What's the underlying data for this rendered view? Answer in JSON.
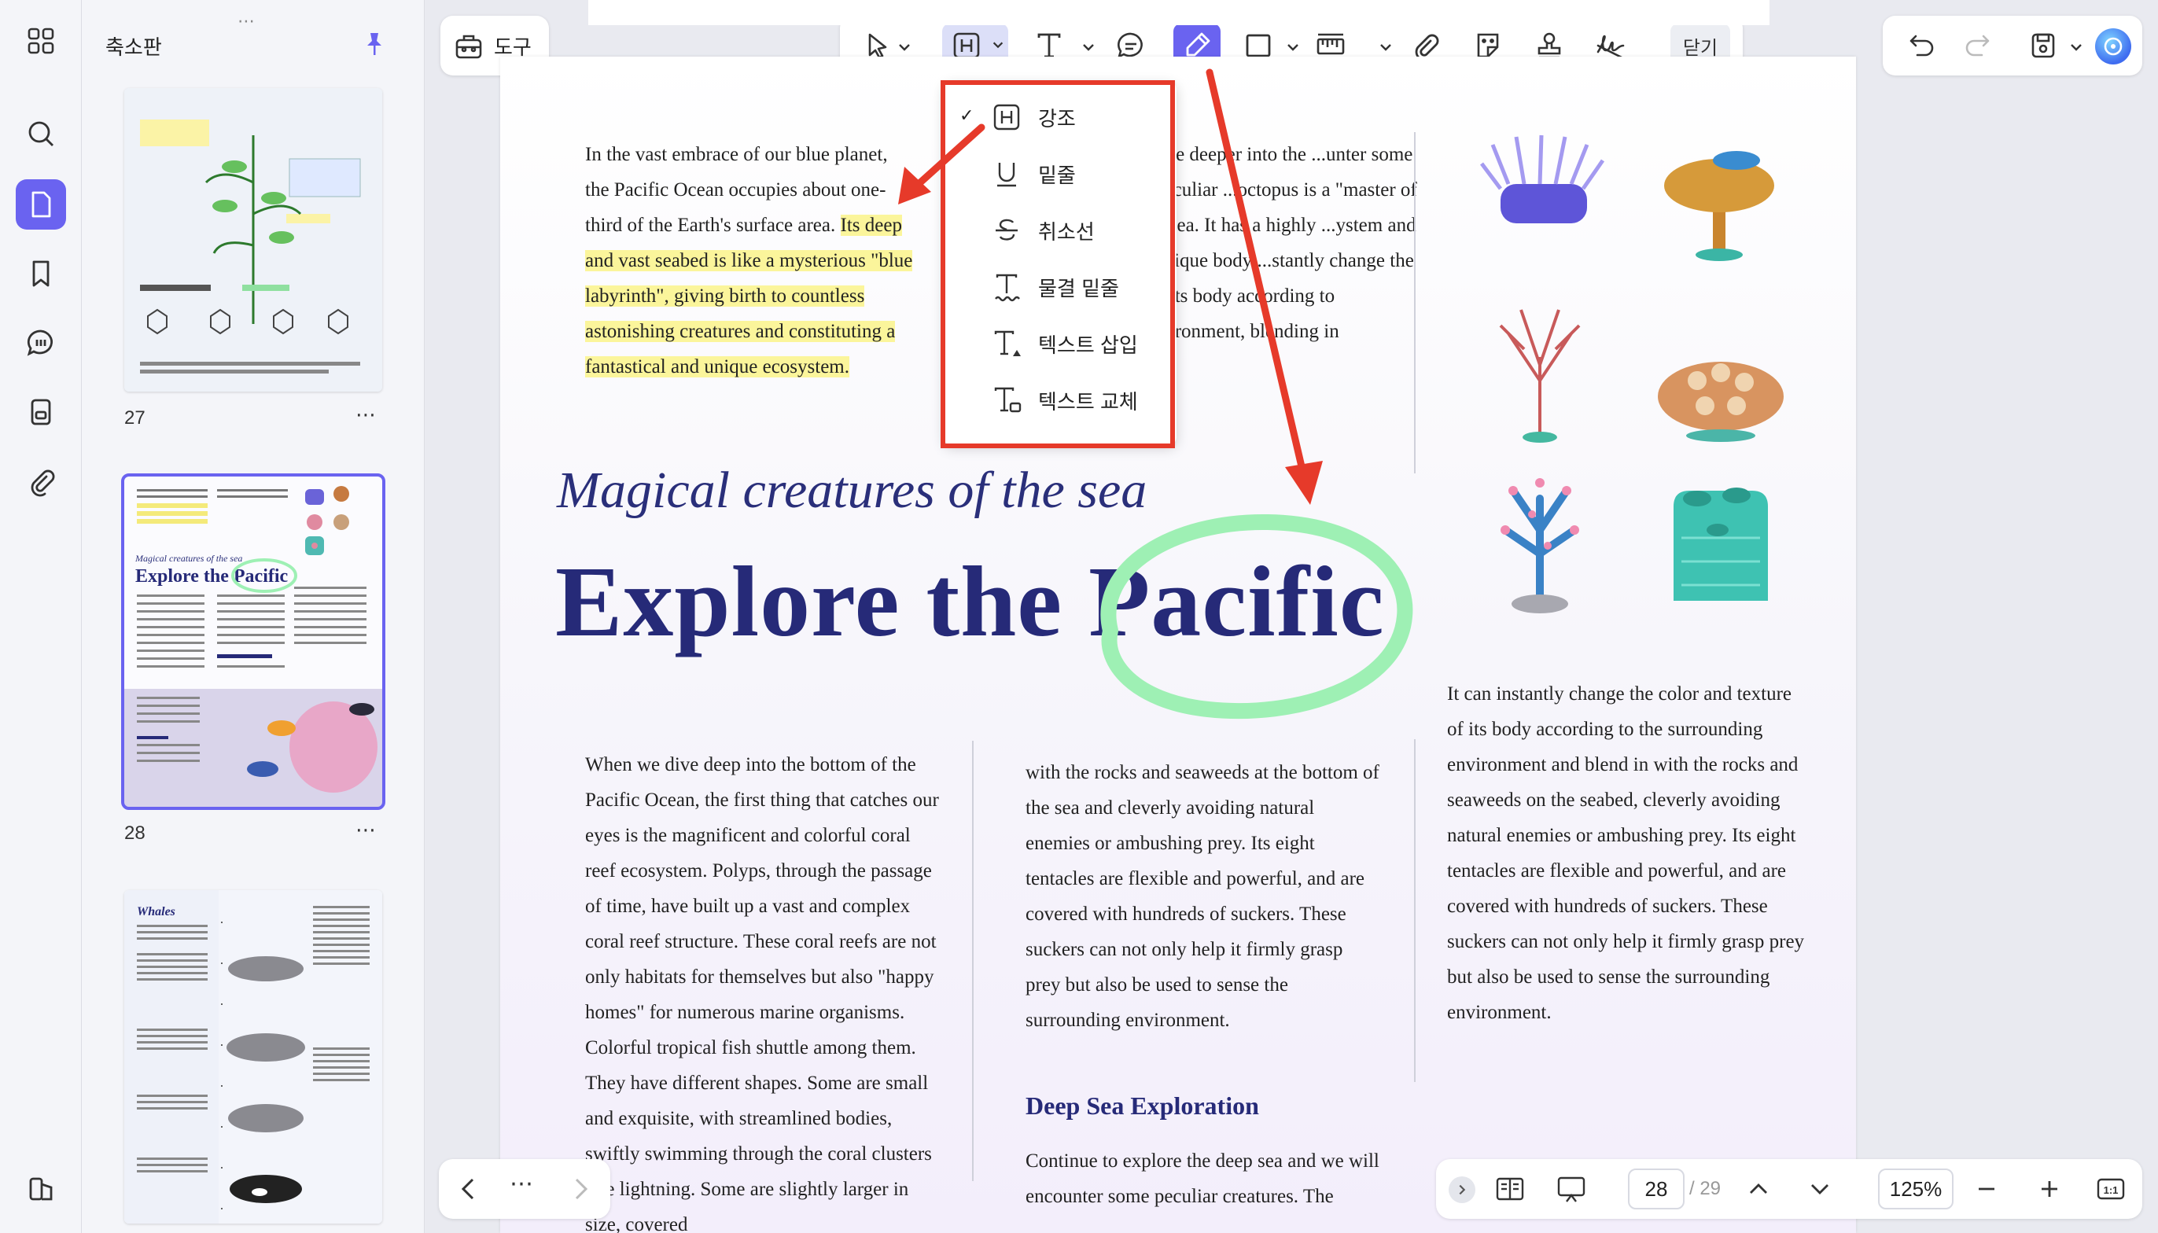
{
  "sidebar": {
    "title": "축소판",
    "thumbnails": [
      {
        "page": "27"
      },
      {
        "page": "28",
        "title_small": "Explore the Pacific"
      },
      {
        "page": "",
        "title_small": "Whales"
      }
    ]
  },
  "toolbar": {
    "tools_label": "도구",
    "close_label": "닫기"
  },
  "dropdown": {
    "items": [
      {
        "label": "강조",
        "checked": true
      },
      {
        "label": "밑줄"
      },
      {
        "label": "취소선"
      },
      {
        "label": "물결 밑줄"
      },
      {
        "label": "텍스트 삽입"
      },
      {
        "label": "텍스트 교체"
      }
    ]
  },
  "document": {
    "col1_para1_normal": "In the vast embrace of our blue planet, the Pacific Ocean occupies about one-third of the Earth's surface area.",
    "col1_para1_highlight": "Its deep and vast seabed is like a mysterious \"blue labyrinth\", giving birth to countless astonishing creatures and constituting a fantastical and unique ecosystem.",
    "col2_top": "...re deeper into the ...unter some peculiar ...octopus is a \"master of ...sea. It has a highly ...ystem and unique body ...stantly change the ...its body according to ...ironment, blending in",
    "subtitle": "Magical creatures of the sea",
    "title": "Explore the Pacific",
    "col1_bottom": "When we dive deep into the bottom of the Pacific Ocean, the first thing that catches our eyes is the magnificent and colorful coral reef ecosystem. Polyps, through the passage of time, have built up a vast and complex coral reef structure. These coral reefs are not only habitats for themselves but also \"happy homes\" for numerous marine organisms. Colorful tropical fish shuttle among them. They have different shapes. Some are small and exquisite, with streamlined bodies, swiftly swimming through the coral clusters like lightning. Some are slightly larger in size, covered",
    "col2_bottom": "with the rocks and seaweeds at the bottom of the sea and cleverly avoiding natural enemies or ambushing prey. Its eight tentacles are flexible and powerful, and are covered with hundreds of suckers. These suckers can not only help it firmly grasp prey but also be used to sense the surrounding environment.",
    "section_heading": "Deep Sea Exploration",
    "section_text": "Continue to explore the deep sea and we will encounter some peculiar creatures. The",
    "col3_text": "It can instantly change the color and texture of its body according to the surrounding environment and blend in with the rocks and seaweeds on the seabed, cleverly avoiding natural enemies or ambushing prey. Its eight tentacles are flexible and powerful, and are covered with hundreds of suckers. These suckers can not only help it firmly grasp prey but also be used to sense the surrounding environment."
  },
  "pager": {
    "current": "28",
    "total": "/ 29",
    "zoom": "125%"
  },
  "colors": {
    "accent": "#6a63f0",
    "title_navy": "#262a78",
    "highlight_yellow": "#fbf59b",
    "red_annotation": "#e63a2a",
    "green_ink": "#9ef0b4"
  }
}
